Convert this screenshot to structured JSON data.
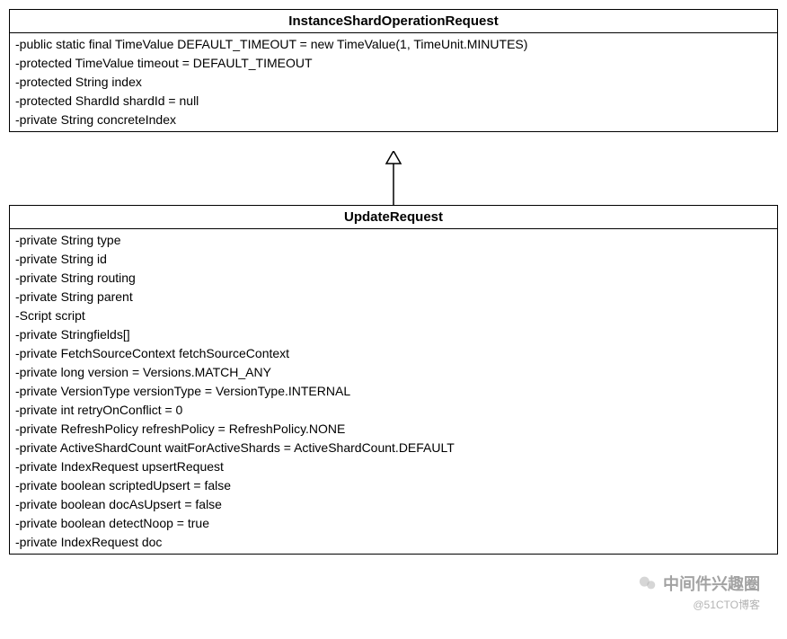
{
  "parentClass": {
    "name": "InstanceShardOperationRequest",
    "attributes": [
      "-public static final TimeValue DEFAULT_TIMEOUT = new TimeValue(1, TimeUnit.MINUTES)",
      "-protected TimeValue timeout = DEFAULT_TIMEOUT",
      "-protected String index",
      "-protected ShardId shardId = null",
      "-private String concreteIndex"
    ]
  },
  "childClass": {
    "name": "UpdateRequest",
    "attributes": [
      "-private String type",
      "-private String id",
      "-private String routing",
      "-private String parent",
      "-Script script",
      "-private Stringfields[]",
      "-private FetchSourceContext fetchSourceContext",
      "-private long version = Versions.MATCH_ANY",
      "-private VersionType versionType = VersionType.INTERNAL",
      "-private int retryOnConflict = 0",
      "-private RefreshPolicy refreshPolicy = RefreshPolicy.NONE",
      "-private ActiveShardCount waitForActiveShards = ActiveShardCount.DEFAULT",
      "-private IndexRequest upsertRequest",
      "-private boolean scriptedUpsert = false",
      "-private boolean docAsUpsert = false",
      "-private boolean detectNoop = true",
      "-private IndexRequest doc"
    ]
  },
  "watermark": {
    "main": "中间件兴趣圈",
    "sub": "@51CTO博客"
  }
}
